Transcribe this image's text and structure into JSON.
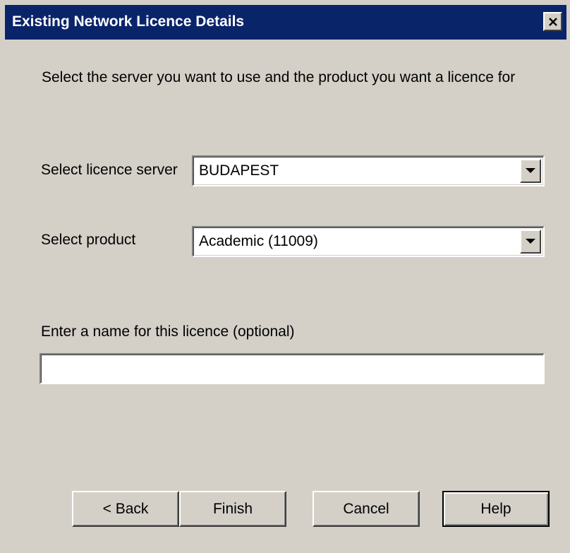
{
  "window": {
    "title": "Existing Network Licence Details",
    "close_icon": "close-icon"
  },
  "intro": {
    "text": "Select the server you want to use and the product you want a licence for"
  },
  "server": {
    "label": "Select licence server",
    "value": "BUDAPEST"
  },
  "product": {
    "label": "Select product",
    "value": "Academic (11009)"
  },
  "name_field": {
    "label": "Enter a name for this licence (optional)",
    "value": ""
  },
  "buttons": {
    "back": "< Back",
    "finish": "Finish",
    "cancel": "Cancel",
    "help": "Help"
  },
  "colors": {
    "titlebar": "#0a246a",
    "face": "#d4d0c8"
  }
}
